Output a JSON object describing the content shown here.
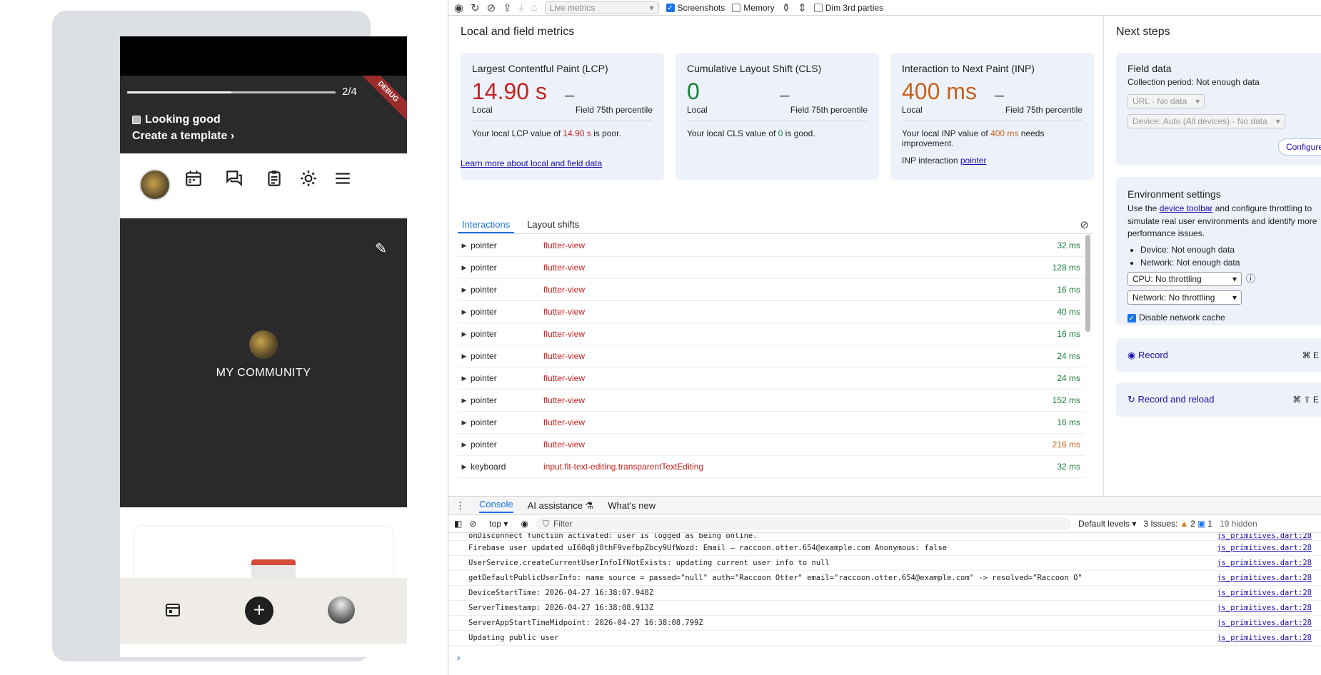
{
  "phone": {
    "step": "2/4",
    "progress": 0.5,
    "debug_label": "DEBUG",
    "check_label": "Looking good",
    "template_label": "Create a template",
    "template_chevron": "›",
    "community_name": "MY COMMUNITY",
    "pencil_glyph": "✎",
    "plus_glyph": "+"
  },
  "toolbar": {
    "live_metrics": "Live metrics",
    "screenshots": "Screenshots",
    "memory": "Memory",
    "dim3rd": "Dim 3rd parties"
  },
  "local": {
    "title": "Local and field metrics",
    "learn_more": "Learn more about local and field data",
    "cards": [
      {
        "title": "Largest Contentful Paint (LCP)",
        "value": "14.90 s",
        "local": "Local",
        "field": "Field 75th percentile",
        "dash": "–",
        "desc_pre": "Your local LCP value of ",
        "desc_val": "14.90 s",
        "desc_post": " is poor.",
        "status": "poor"
      },
      {
        "title": "Cumulative Layout Shift (CLS)",
        "value": "0",
        "local": "Local",
        "field": "Field 75th percentile",
        "dash": "–",
        "desc_pre": "Your local CLS value of ",
        "desc_val": "0",
        "desc_post": " is good.",
        "status": "good"
      },
      {
        "title": "Interaction to Next Paint (INP)",
        "value": "400 ms",
        "local": "Local",
        "field": "Field 75th percentile",
        "dash": "–",
        "desc_pre": "Your local INP value of ",
        "desc_val": "400 ms",
        "desc_post": " needs improvement.",
        "status": "warn",
        "extra_label": "INP interaction",
        "extra_link": "pointer"
      }
    ]
  },
  "interactions": {
    "tabs": [
      "Interactions",
      "Layout shifts"
    ],
    "rows": [
      {
        "type": "pointer",
        "el": "flutter-view",
        "ms": "32 ms",
        "status": "good"
      },
      {
        "type": "pointer",
        "el": "flutter-view",
        "ms": "128 ms",
        "status": "good"
      },
      {
        "type": "pointer",
        "el": "flutter-view",
        "ms": "16 ms",
        "status": "good"
      },
      {
        "type": "pointer",
        "el": "flutter-view",
        "ms": "40 ms",
        "status": "good"
      },
      {
        "type": "pointer",
        "el": "flutter-view",
        "ms": "16 ms",
        "status": "good"
      },
      {
        "type": "pointer",
        "el": "flutter-view",
        "ms": "24 ms",
        "status": "good"
      },
      {
        "type": "pointer",
        "el": "flutter-view",
        "ms": "24 ms",
        "status": "good"
      },
      {
        "type": "pointer",
        "el": "flutter-view",
        "ms": "152 ms",
        "status": "good"
      },
      {
        "type": "pointer",
        "el": "flutter-view",
        "ms": "16 ms",
        "status": "good"
      },
      {
        "type": "pointer",
        "el": "flutter-view",
        "ms": "216 ms",
        "status": "warn"
      },
      {
        "type": "keyboard",
        "el": "input.flt-text-editing.transparentTextEditing",
        "ms": "32 ms",
        "status": "good"
      }
    ]
  },
  "next": {
    "title": "Next steps",
    "field_title": "Field data",
    "collection": "Collection period: Not enough data",
    "url_dd": "URL - No data",
    "device_dd": "Device: Auto (All devices) - No data",
    "configure": "Configure",
    "env_title": "Environment settings",
    "env_pre": "Use the ",
    "env_link": "device toolbar",
    "env_post": " and configure throttling to simulate real user environments and identify more performance issues.",
    "device_item": "Device: Not enough data",
    "network_item": "Network: Not enough data",
    "cpu": "CPU: No throttling",
    "network": "Network: No throttling",
    "disable_cache": "Disable network cache",
    "record": "Record",
    "record_key": "⌘ E",
    "record_reload": "Record and reload",
    "record_reload_key": "⌘ ⇧ E"
  },
  "console": {
    "tabs": [
      "Console",
      "AI assistance",
      "What's new"
    ],
    "context": "top",
    "filter": "Filter",
    "levels": "Default levels",
    "issues_label": "3 Issues:",
    "issues_warn": "2",
    "issues_info": "1",
    "hidden": "19 hidden",
    "logs": [
      {
        "text": "onDisconnect function activated: user is logged as being online.",
        "src": "js_primitives.dart:28"
      },
      {
        "text": "Firebase user updated uI60q8j8thF9vefbpZbcy9UfWozd: Email – raccoon.otter.654@example.com Anonymous: false",
        "src": "js_primitives.dart:28"
      },
      {
        "text": "UserService.createCurrentUserInfoIfNotExists: updating current user info to null",
        "src": "js_primitives.dart:28"
      },
      {
        "text": "getDefaultPublicUserInfo: name source = passed=\"null\" auth=\"Raccoon Otter\" email=\"raccoon.otter.654@example.com\" -> resolved=\"Raccoon O\"",
        "src": "js_primitives.dart:28"
      },
      {
        "text": "DeviceStartTime: 2026-04-27 16:38:07.948Z",
        "src": "js_primitives.dart:28"
      },
      {
        "text": "ServerTimestamp: 2026-04-27 16:38:08.913Z",
        "src": "js_primitives.dart:28"
      },
      {
        "text": "ServerAppStartTimeMidpoint: 2026-04-27 16:38:08.799Z",
        "src": "js_primitives.dart:28"
      },
      {
        "text": "Updating public user",
        "src": "js_primitives.dart:28"
      }
    ]
  }
}
